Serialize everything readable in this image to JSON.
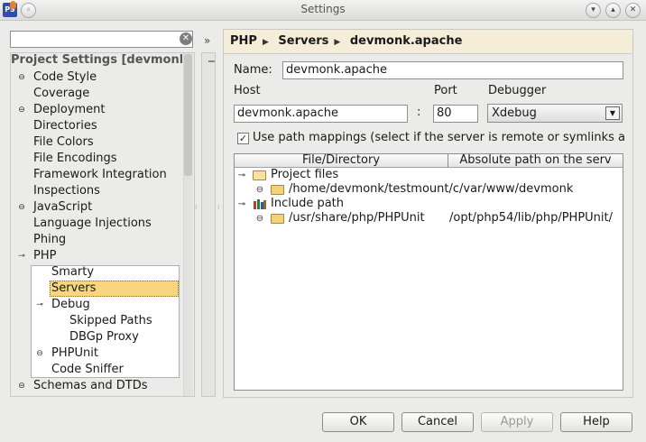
{
  "window": {
    "title": "Settings"
  },
  "sidebar": {
    "search": {
      "value": ""
    },
    "items": [
      {
        "label": "Project Settings [devmonk]"
      },
      {
        "label": "Code Style"
      },
      {
        "label": "Coverage"
      },
      {
        "label": "Deployment"
      },
      {
        "label": "Directories"
      },
      {
        "label": "File Colors"
      },
      {
        "label": "File Encodings"
      },
      {
        "label": "Framework Integration"
      },
      {
        "label": "Inspections"
      },
      {
        "label": "JavaScript"
      },
      {
        "label": "Language Injections"
      },
      {
        "label": "Phing"
      },
      {
        "label": "PHP"
      },
      {
        "label": "Smarty"
      },
      {
        "label": "Servers"
      },
      {
        "label": "Debug"
      },
      {
        "label": "Skipped Paths"
      },
      {
        "label": "DBGp Proxy"
      },
      {
        "label": "PHPUnit"
      },
      {
        "label": "Code Sniffer"
      },
      {
        "label": "Schemas and DTDs"
      }
    ],
    "selected": "Servers"
  },
  "breadcrumb": [
    "PHP",
    "Servers",
    "devmonk.apache"
  ],
  "form": {
    "name_label": "Name:",
    "name_value": "devmonk.apache",
    "host_label": "Host",
    "host_value": "devmonk.apache",
    "port_label": "Port",
    "port_value": "80",
    "colon": ":",
    "debugger_label": "Debugger",
    "debugger_value": "Xdebug",
    "mappings_label": "Use path mappings (select if the server is remote or symlinks are",
    "mappings_checked": true
  },
  "mappings_table": {
    "columns": [
      "File/Directory",
      "Absolute path on the serv"
    ],
    "rows": [
      {
        "label": "Project files",
        "path": ""
      },
      {
        "label": "/home/devmonk/testmount/c/var/www/devmonk",
        "path": ""
      },
      {
        "label": "Include path",
        "path": ""
      },
      {
        "label": "/usr/share/php/PHPUnit",
        "path": "/opt/php54/lib/php/PHPUnit/"
      }
    ]
  },
  "buttons": {
    "ok": "OK",
    "cancel": "Cancel",
    "apply": "Apply",
    "help": "Help"
  },
  "colors": {
    "selection": "#f8d57e",
    "breadcrumb_bg": "#f6edd9",
    "window_bg": "#ebebea"
  }
}
